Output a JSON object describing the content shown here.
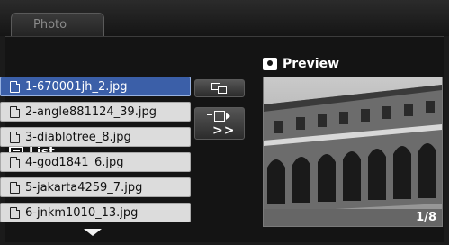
{
  "tab": {
    "label": "Photo"
  },
  "list_section": {
    "title": "List",
    "icon": "list-icon"
  },
  "preview_section": {
    "title": "Preview",
    "icon": "picture-icon",
    "counter": "1/8"
  },
  "files": [
    {
      "name": "1-670001jh_2.jpg",
      "selected": true
    },
    {
      "name": "2-angle881124_39.jpg",
      "selected": false
    },
    {
      "name": "3-diablotree_8.jpg",
      "selected": false
    },
    {
      "name": "4-god1841_6.jpg",
      "selected": false
    },
    {
      "name": "5-jakarta4259_7.jpg",
      "selected": false
    },
    {
      "name": "6-jnkm1010_13.jpg",
      "selected": false
    }
  ],
  "toolbar": {
    "copy_icon": "copy-icon",
    "move_icon": "move-icon",
    "more_label": ">>"
  },
  "colors": {
    "selection": "#3b5fa8",
    "row_bg": "#dcdcdc",
    "background": "#141414"
  }
}
